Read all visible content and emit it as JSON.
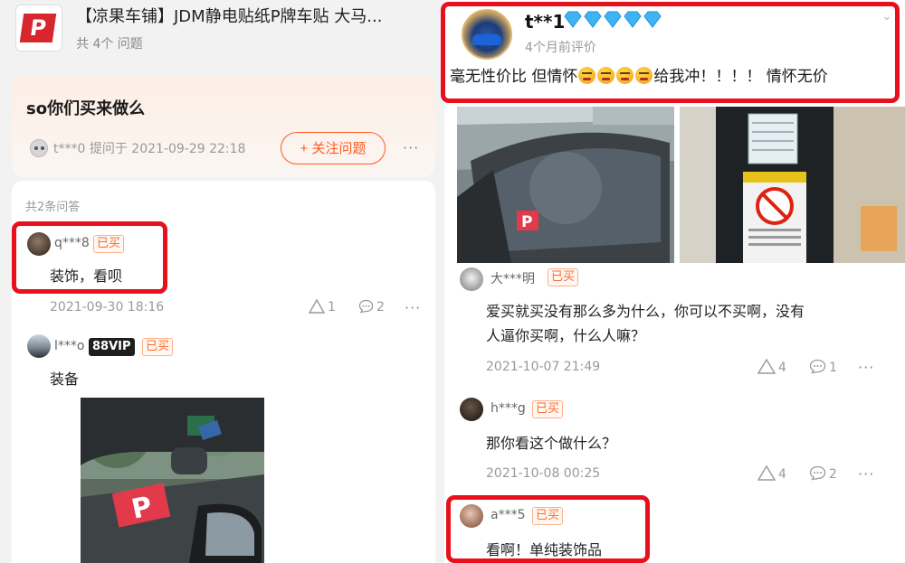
{
  "product": {
    "thumb_letter": "P",
    "title": "【凉果车铺】JDM静电贴纸P牌车贴 大马...",
    "question_count": "共 4个 问题"
  },
  "question": {
    "title": "so你们买来做么",
    "asker": "t***0",
    "asked_at": "提问于 2021-09-29 22:18",
    "follow_label": "+ 关注问题",
    "more": "···"
  },
  "answers": {
    "count_label": "共2条问答",
    "items": [
      {
        "user": "q***8",
        "tag": "已买",
        "text": "装饰，看呗",
        "date": "2021-09-30 18:16",
        "likes": "1",
        "comments": "2",
        "more": "···"
      },
      {
        "user": "l***o",
        "vip": "88VIP",
        "tag": "已买",
        "text": "装备"
      }
    ]
  },
  "review": {
    "user": "t**1",
    "time": "4个月前评价",
    "text_before": "毫无性价比  但情怀",
    "text_after": "给我冲！！！！  情怀无价",
    "emoji_count": 4,
    "expand_icon": "chevron-down-icon"
  },
  "replies": [
    {
      "user": "大***明",
      "tag": "已买",
      "text_line1": "爱买就买没有那么多为什么，你可以不买啊，没有",
      "text_line2": "人逼你买啊，什么人嘛？",
      "date": "2021-10-07 21:49",
      "likes": "4",
      "comments": "1",
      "more": "···"
    },
    {
      "user": "h***g",
      "tag": "已买",
      "text": "那你看这个做什么？",
      "date": "2021-10-08 00:25",
      "likes": "4",
      "comments": "2",
      "more": "···"
    },
    {
      "user": "a***5",
      "tag": "已买",
      "text": "看啊！单纯装饰品"
    }
  ],
  "colors": {
    "accent": "#ff5a1f",
    "highlight": "#e8101d",
    "diamond": "#3fb4f5"
  }
}
